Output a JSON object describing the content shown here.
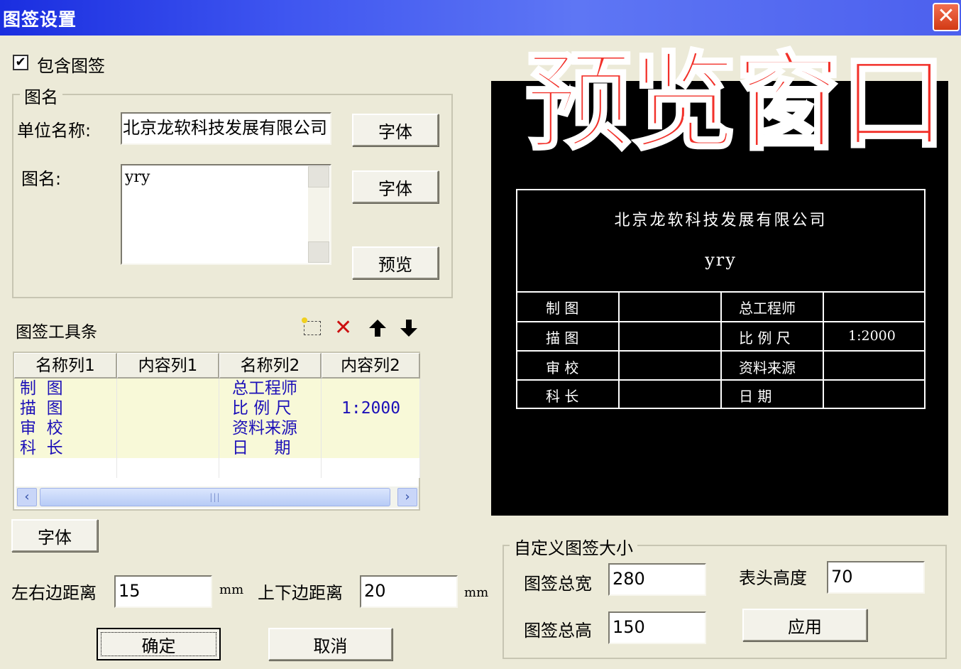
{
  "window": {
    "title": "图签设置",
    "close_symbol": "✕"
  },
  "include_checkbox": {
    "label": "包含图签",
    "checked": true,
    "check_symbol": "✔"
  },
  "name_group": {
    "legend": "图名",
    "unit_label": "单位名称:",
    "unit_value": "北京龙软科技发展有限公司",
    "unit_font_button": "字体",
    "title_label": "图名:",
    "title_value": "yry",
    "title_font_button": "字体",
    "preview_button": "预览"
  },
  "toolbar": {
    "label": "图签工具条",
    "icons": [
      "add-row-icon",
      "delete-icon",
      "move-up-icon",
      "move-down-icon"
    ],
    "delete_symbol": "✕",
    "up_symbol": "🡅",
    "down_symbol": "🡇",
    "delete_color": "#cc1010"
  },
  "grid": {
    "columns": [
      "名称列1",
      "内容列1",
      "名称列2",
      "内容列2"
    ],
    "rows": [
      [
        "制  图",
        "",
        "总工程师",
        ""
      ],
      [
        "描  图",
        "",
        "比 例 尺",
        "1:2000"
      ],
      [
        "审  校",
        "",
        "资料来源",
        ""
      ],
      [
        "科  长",
        "",
        "日     期",
        ""
      ]
    ],
    "scroll_left": "‹",
    "scroll_right": "›",
    "thumb_grip": "|||",
    "row_color": "#1c10b8"
  },
  "grid_font_button": "字体",
  "margins": {
    "lr_label": "左右边距离",
    "lr_value": "15",
    "lr_unit": "mm",
    "tb_label": "上下边距离",
    "tb_value": "20",
    "tb_unit": "mm"
  },
  "ok_button": "确定",
  "cancel_button": "取消",
  "preview": {
    "overlay_label": "预览窗口",
    "company": "北京龙软科技发展有限公司",
    "title": "yry",
    "cells": [
      [
        "制  图",
        "",
        "总工程师",
        ""
      ],
      [
        "描  图",
        "",
        "比 例 尺",
        "1:2000"
      ],
      [
        "审  校",
        "",
        "资料来源",
        ""
      ],
      [
        "科  长",
        "",
        "日    期",
        ""
      ]
    ],
    "overlay_color": "#f2312a"
  },
  "size_group": {
    "legend": "自定义图签大小",
    "width_label": "图签总宽",
    "width_value": "280",
    "header_label": "表头高度",
    "header_value": "70",
    "height_label": "图签总高",
    "height_value": "150",
    "apply_button": "应用"
  }
}
